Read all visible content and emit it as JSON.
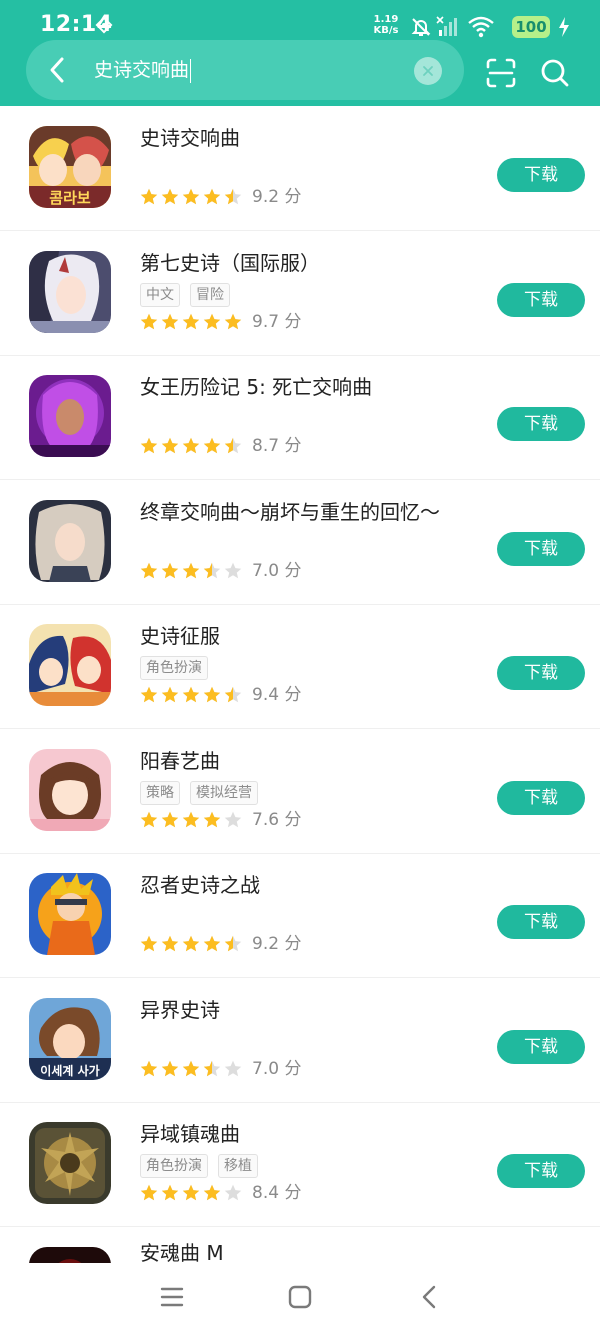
{
  "status_bar": {
    "time": "12:14",
    "net_speed_value": "1.19",
    "net_speed_unit": "KB/s",
    "battery": "100"
  },
  "search": {
    "query": "史诗交响曲"
  },
  "colors": {
    "header": "#25bfa3",
    "download_button": "#20b99e",
    "star_filled": "#fcbd20",
    "star_empty": "#dddddd"
  },
  "results": [
    {
      "name": "史诗交响曲",
      "tags": [],
      "stars": 4.5,
      "score": "9.2 分",
      "button": "下载",
      "icon": "anime-duo-game-icon"
    },
    {
      "name": "第七史诗（国际服）",
      "tags": [
        "中文",
        "冒险"
      ],
      "stars": 5,
      "score": "9.7 分",
      "button": "下载",
      "icon": "white-hair-girl-game-icon"
    },
    {
      "name": "女王历险记 5: 死亡交响曲",
      "tags": [],
      "stars": 4.5,
      "score": "8.7 分",
      "button": "下载",
      "icon": "purple-queen-game-icon"
    },
    {
      "name": "终章交响曲～崩坏与重生的回忆～",
      "tags": [],
      "stars": 3.5,
      "score": "7.0 分",
      "button": "下载",
      "icon": "silver-hair-girl-game-icon"
    },
    {
      "name": "史诗征服",
      "tags": [
        "角色扮演"
      ],
      "stars": 4.5,
      "score": "9.4 分",
      "button": "下载",
      "icon": "anime-heroes-game-icon"
    },
    {
      "name": "阳春艺曲",
      "tags": [
        "策略",
        "模拟经营"
      ],
      "stars": 4,
      "score": "7.6 分",
      "button": "下载",
      "icon": "brown-hair-girl-game-icon"
    },
    {
      "name": "忍者史诗之战",
      "tags": [],
      "stars": 4.5,
      "score": "9.2 分",
      "button": "下载",
      "icon": "ninja-game-icon"
    },
    {
      "name": "异界史诗",
      "tags": [],
      "stars": 3.5,
      "score": "7.0 分",
      "button": "下载",
      "icon": "brown-hair-boy-game-icon"
    },
    {
      "name": "异域镇魂曲",
      "tags": [
        "角色扮演",
        "移植"
      ],
      "stars": 4,
      "score": "8.4 分",
      "button": "下载",
      "icon": "bronze-mask-game-icon"
    },
    {
      "name": "安魂曲 M",
      "tags": [],
      "stars": 0,
      "score": "",
      "button": "",
      "icon": "dark-red-game-icon"
    }
  ],
  "icon_lettering": {
    "row1": "콤라보",
    "row8": "이세계 사가"
  }
}
